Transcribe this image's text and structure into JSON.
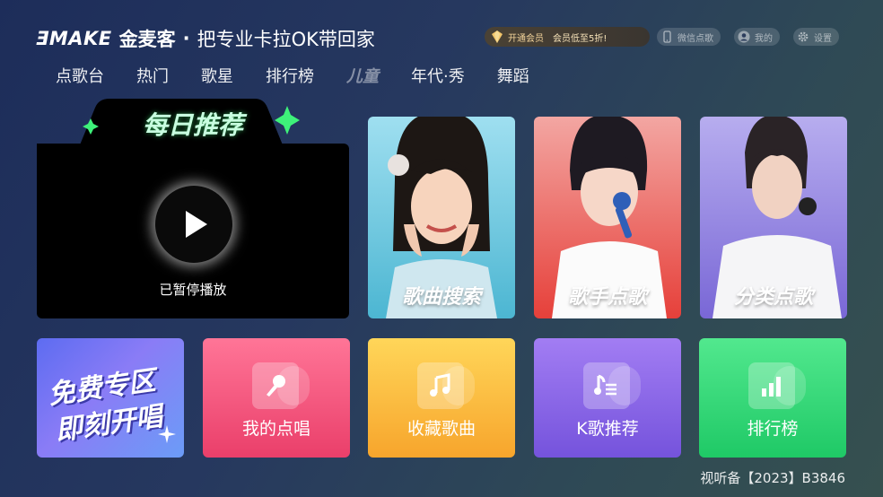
{
  "header": {
    "logo_text": "ƎMAKE",
    "brand_name": "金麦客",
    "separator": "·",
    "slogan": "把专业卡拉OK带回家",
    "vip": {
      "label": "开通会员",
      "promo": "会员低至5折!"
    },
    "wechat_order_label": "微信点歌",
    "my_label": "我的",
    "settings_label": "设置"
  },
  "nav": {
    "tabs": [
      {
        "label": "点歌台"
      },
      {
        "label": "热门"
      },
      {
        "label": "歌星"
      },
      {
        "label": "排行榜"
      },
      {
        "label": "儿童"
      },
      {
        "label": "年代·秀"
      },
      {
        "label": "舞蹈"
      }
    ]
  },
  "daily": {
    "title": "每日推荐",
    "status": "已暂停播放"
  },
  "cards": [
    {
      "label": "歌曲搜索",
      "color_top": "#8fd8ea",
      "color_bottom": "#56c0d8"
    },
    {
      "label": "歌手点歌",
      "color_top": "#f49a96",
      "color_bottom": "#e8453f"
    },
    {
      "label": "分类点歌",
      "color_top": "#b2a8ee",
      "color_bottom": "#7d6ad8"
    }
  ],
  "tiles": [
    {
      "line1": "免费专区",
      "line2": "即刻开唱"
    },
    {
      "label": "我的点唱",
      "icon": "microphone-icon"
    },
    {
      "label": "收藏歌曲",
      "icon": "music-note-icon"
    },
    {
      "label": "K歌推荐",
      "icon": "music-list-icon"
    },
    {
      "label": "排行榜",
      "icon": "bar-chart-icon"
    }
  ],
  "footer": {
    "license": "视听备【2023】B3846"
  }
}
